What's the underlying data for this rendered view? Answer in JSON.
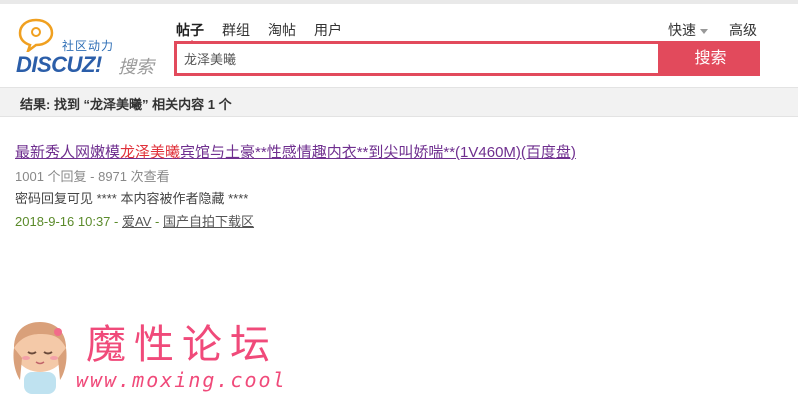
{
  "logo": {
    "community_label": "社区动力",
    "brand_name": "DISCUZ!",
    "search_label": "搜索"
  },
  "nav": {
    "tabs": [
      {
        "label": "帖子",
        "active": true
      },
      {
        "label": "群组",
        "active": false
      },
      {
        "label": "淘帖",
        "active": false
      },
      {
        "label": "用户",
        "active": false
      }
    ],
    "quick_label": "快速",
    "advanced_label": "高级"
  },
  "search": {
    "value": "龙泽美曦",
    "button_label": "搜索"
  },
  "summary": {
    "text": "结果: 找到 “龙泽美曦” 相关内容 1 个"
  },
  "results": [
    {
      "title_before": "最新秀人网嫩模",
      "title_highlight": "龙泽美曦",
      "title_after": "宾馆与土豪**性感情趣内衣**到尖叫娇喘**(1V460M)(百度盘)",
      "meta": "1001 个回复 - 8971 次查看",
      "description": "密码回复可见 **** 本内容被作者隐藏 ****",
      "date": "2018-9-16 10:37",
      "separator": "-",
      "author": "爱AV",
      "forum": "国产自拍下载区"
    }
  ],
  "watermark": {
    "site_name": "魔性论坛",
    "url": "www.moxing.cool"
  },
  "colors": {
    "accent": "#e24a5c",
    "highlight": "#e0313b",
    "title_link": "#6f2f8f",
    "date_green": "#5a8a2a",
    "brand_blue": "#2b5ea9",
    "watermark_pink": "#f04a7a"
  }
}
